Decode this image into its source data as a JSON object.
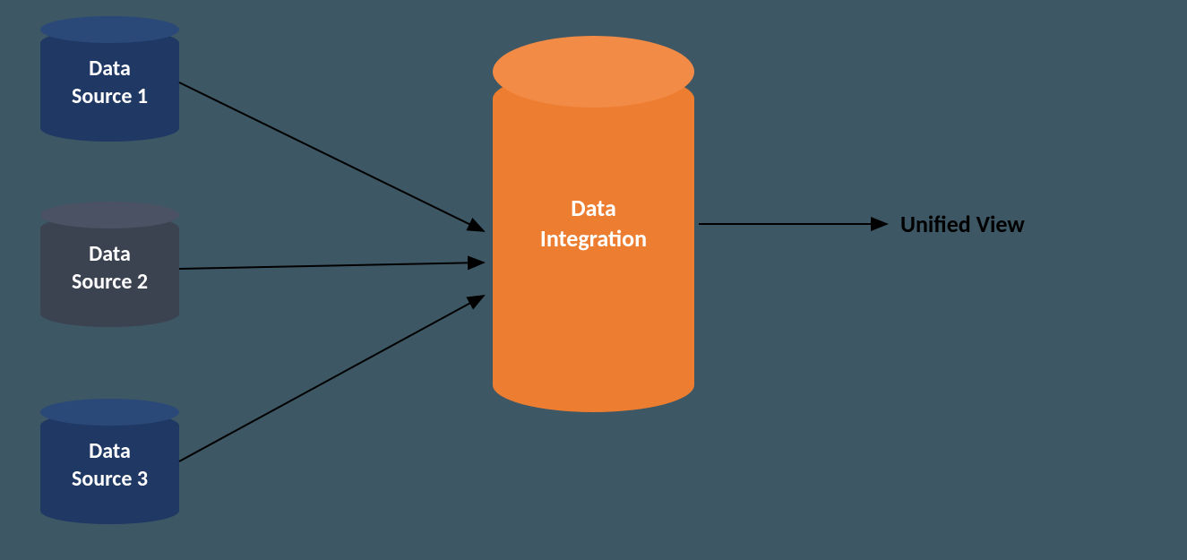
{
  "sources": [
    {
      "label": "Data\nSource 1"
    },
    {
      "label": "Data\nSource 2"
    },
    {
      "label": "Data\nSource 3"
    }
  ],
  "integration": {
    "label": "Data\nIntegration"
  },
  "output": {
    "label": "Unified View"
  }
}
